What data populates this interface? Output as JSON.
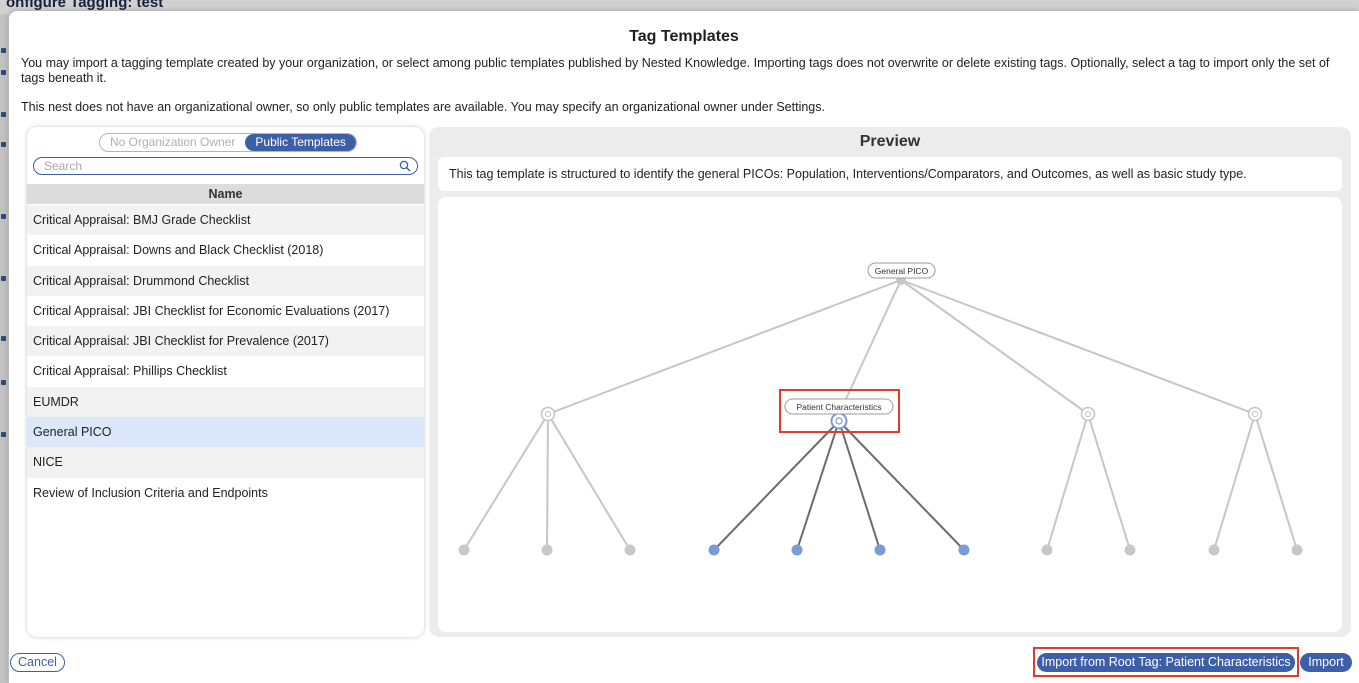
{
  "background": {
    "page_title": "onfigure Tagging: test"
  },
  "modal": {
    "title": "Tag Templates",
    "intro": "You may import a tagging template created by your organization, or select among public templates published by Nested Knowledge. Importing tags does not overwrite or delete existing tags. Optionally, select a tag to import only the set of tags beneath it.",
    "owner_note": "This nest does not have an organizational owner, so only public templates are available. You may specify an organizational owner under Settings."
  },
  "left_panel": {
    "toggle": {
      "option_org": "No Organization Owner",
      "option_public": "Public Templates",
      "active": "Public Templates"
    },
    "search": {
      "placeholder": "Search",
      "value": ""
    },
    "column_header": "Name",
    "templates": [
      "Critical Appraisal: BMJ Grade Checklist",
      "Critical Appraisal: Downs and Black Checklist (2018)",
      "Critical Appraisal: Drummond Checklist",
      "Critical Appraisal: JBI Checklist for Economic Evaluations (2017)",
      "Critical Appraisal: JBI Checklist for Prevalence (2017)",
      "Critical Appraisal: Phillips Checklist",
      "EUMDR",
      "General PICO",
      "NICE",
      "Review of Inclusion Criteria and Endpoints"
    ],
    "selected_template": "General PICO"
  },
  "preview": {
    "title": "Preview",
    "description": "This tag template is structured to identify the general PICOs: Population, Interventions/Comparators, and Outcomes, as well as basic study type.",
    "tree": {
      "root_label": "General PICO",
      "selected_label": "Patient Characteristics",
      "colors": {
        "edge": "#c6c6c6",
        "edge_selected": "#6b6b6b",
        "leaf": "#c8c8c8",
        "leaf_selected": "#7b9bd8",
        "highlight": "#e23b2e"
      }
    }
  },
  "footer": {
    "cancel_label": "Cancel",
    "import_root_label": "Import from Root Tag: Patient Characteristics",
    "import_label": "Import"
  },
  "icons": {
    "search": "search-icon"
  }
}
